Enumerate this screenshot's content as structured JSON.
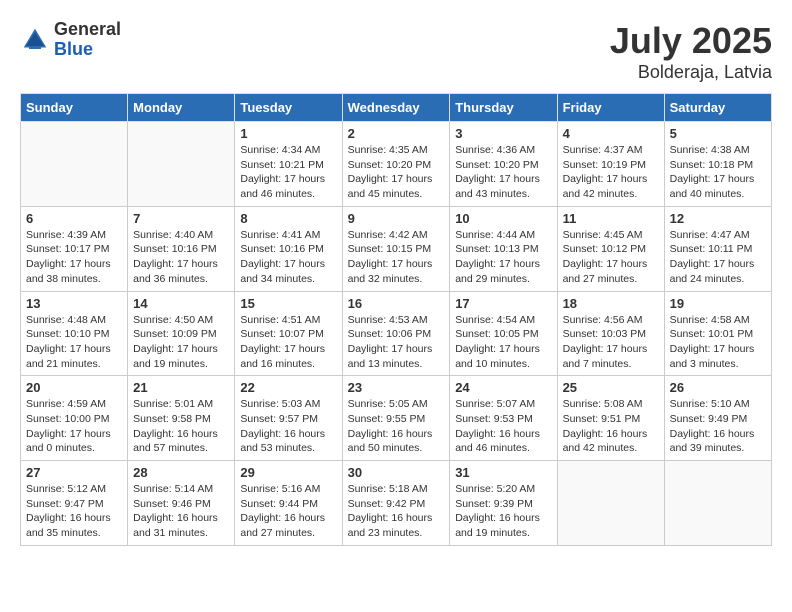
{
  "logo": {
    "general": "General",
    "blue": "Blue"
  },
  "title": "July 2025",
  "subtitle": "Bolderaja, Latvia",
  "days_header": [
    "Sunday",
    "Monday",
    "Tuesday",
    "Wednesday",
    "Thursday",
    "Friday",
    "Saturday"
  ],
  "weeks": [
    [
      {
        "day": "",
        "info": ""
      },
      {
        "day": "",
        "info": ""
      },
      {
        "day": "1",
        "info": "Sunrise: 4:34 AM\nSunset: 10:21 PM\nDaylight: 17 hours\nand 46 minutes."
      },
      {
        "day": "2",
        "info": "Sunrise: 4:35 AM\nSunset: 10:20 PM\nDaylight: 17 hours\nand 45 minutes."
      },
      {
        "day": "3",
        "info": "Sunrise: 4:36 AM\nSunset: 10:20 PM\nDaylight: 17 hours\nand 43 minutes."
      },
      {
        "day": "4",
        "info": "Sunrise: 4:37 AM\nSunset: 10:19 PM\nDaylight: 17 hours\nand 42 minutes."
      },
      {
        "day": "5",
        "info": "Sunrise: 4:38 AM\nSunset: 10:18 PM\nDaylight: 17 hours\nand 40 minutes."
      }
    ],
    [
      {
        "day": "6",
        "info": "Sunrise: 4:39 AM\nSunset: 10:17 PM\nDaylight: 17 hours\nand 38 minutes."
      },
      {
        "day": "7",
        "info": "Sunrise: 4:40 AM\nSunset: 10:16 PM\nDaylight: 17 hours\nand 36 minutes."
      },
      {
        "day": "8",
        "info": "Sunrise: 4:41 AM\nSunset: 10:16 PM\nDaylight: 17 hours\nand 34 minutes."
      },
      {
        "day": "9",
        "info": "Sunrise: 4:42 AM\nSunset: 10:15 PM\nDaylight: 17 hours\nand 32 minutes."
      },
      {
        "day": "10",
        "info": "Sunrise: 4:44 AM\nSunset: 10:13 PM\nDaylight: 17 hours\nand 29 minutes."
      },
      {
        "day": "11",
        "info": "Sunrise: 4:45 AM\nSunset: 10:12 PM\nDaylight: 17 hours\nand 27 minutes."
      },
      {
        "day": "12",
        "info": "Sunrise: 4:47 AM\nSunset: 10:11 PM\nDaylight: 17 hours\nand 24 minutes."
      }
    ],
    [
      {
        "day": "13",
        "info": "Sunrise: 4:48 AM\nSunset: 10:10 PM\nDaylight: 17 hours\nand 21 minutes."
      },
      {
        "day": "14",
        "info": "Sunrise: 4:50 AM\nSunset: 10:09 PM\nDaylight: 17 hours\nand 19 minutes."
      },
      {
        "day": "15",
        "info": "Sunrise: 4:51 AM\nSunset: 10:07 PM\nDaylight: 17 hours\nand 16 minutes."
      },
      {
        "day": "16",
        "info": "Sunrise: 4:53 AM\nSunset: 10:06 PM\nDaylight: 17 hours\nand 13 minutes."
      },
      {
        "day": "17",
        "info": "Sunrise: 4:54 AM\nSunset: 10:05 PM\nDaylight: 17 hours\nand 10 minutes."
      },
      {
        "day": "18",
        "info": "Sunrise: 4:56 AM\nSunset: 10:03 PM\nDaylight: 17 hours\nand 7 minutes."
      },
      {
        "day": "19",
        "info": "Sunrise: 4:58 AM\nSunset: 10:01 PM\nDaylight: 17 hours\nand 3 minutes."
      }
    ],
    [
      {
        "day": "20",
        "info": "Sunrise: 4:59 AM\nSunset: 10:00 PM\nDaylight: 17 hours\nand 0 minutes."
      },
      {
        "day": "21",
        "info": "Sunrise: 5:01 AM\nSunset: 9:58 PM\nDaylight: 16 hours\nand 57 minutes."
      },
      {
        "day": "22",
        "info": "Sunrise: 5:03 AM\nSunset: 9:57 PM\nDaylight: 16 hours\nand 53 minutes."
      },
      {
        "day": "23",
        "info": "Sunrise: 5:05 AM\nSunset: 9:55 PM\nDaylight: 16 hours\nand 50 minutes."
      },
      {
        "day": "24",
        "info": "Sunrise: 5:07 AM\nSunset: 9:53 PM\nDaylight: 16 hours\nand 46 minutes."
      },
      {
        "day": "25",
        "info": "Sunrise: 5:08 AM\nSunset: 9:51 PM\nDaylight: 16 hours\nand 42 minutes."
      },
      {
        "day": "26",
        "info": "Sunrise: 5:10 AM\nSunset: 9:49 PM\nDaylight: 16 hours\nand 39 minutes."
      }
    ],
    [
      {
        "day": "27",
        "info": "Sunrise: 5:12 AM\nSunset: 9:47 PM\nDaylight: 16 hours\nand 35 minutes."
      },
      {
        "day": "28",
        "info": "Sunrise: 5:14 AM\nSunset: 9:46 PM\nDaylight: 16 hours\nand 31 minutes."
      },
      {
        "day": "29",
        "info": "Sunrise: 5:16 AM\nSunset: 9:44 PM\nDaylight: 16 hours\nand 27 minutes."
      },
      {
        "day": "30",
        "info": "Sunrise: 5:18 AM\nSunset: 9:42 PM\nDaylight: 16 hours\nand 23 minutes."
      },
      {
        "day": "31",
        "info": "Sunrise: 5:20 AM\nSunset: 9:39 PM\nDaylight: 16 hours\nand 19 minutes."
      },
      {
        "day": "",
        "info": ""
      },
      {
        "day": "",
        "info": ""
      }
    ]
  ]
}
